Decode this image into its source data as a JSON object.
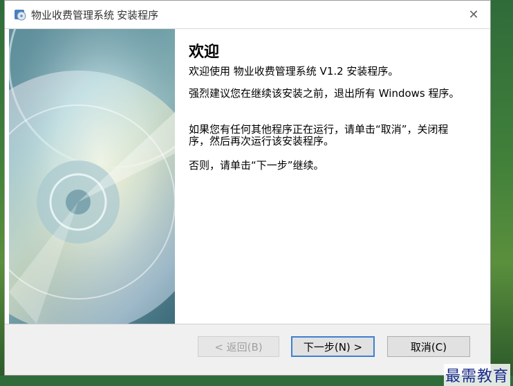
{
  "window": {
    "title": "物业收费管理系统 安装程序",
    "close_glyph": "✕"
  },
  "welcome": {
    "heading": "欢迎",
    "line1": "欢迎使用 物业收费管理系统 V1.2 安装程序。",
    "line2": "强烈建议您在继续该安装之前，退出所有 Windows 程序。",
    "line3": "如果您有任何其他程序正在运行，请单击“取消”，关闭程序，然后再次运行该安装程序。",
    "line4": "否则，请单击“下一步”继续。"
  },
  "buttons": {
    "back": "< 返回(B)",
    "next": "下一步(N) >",
    "cancel": "取消(C)"
  },
  "watermark": "最需教育",
  "colors": {
    "default_border": "#3c7fd1",
    "watermark": "#1a2a8a"
  }
}
